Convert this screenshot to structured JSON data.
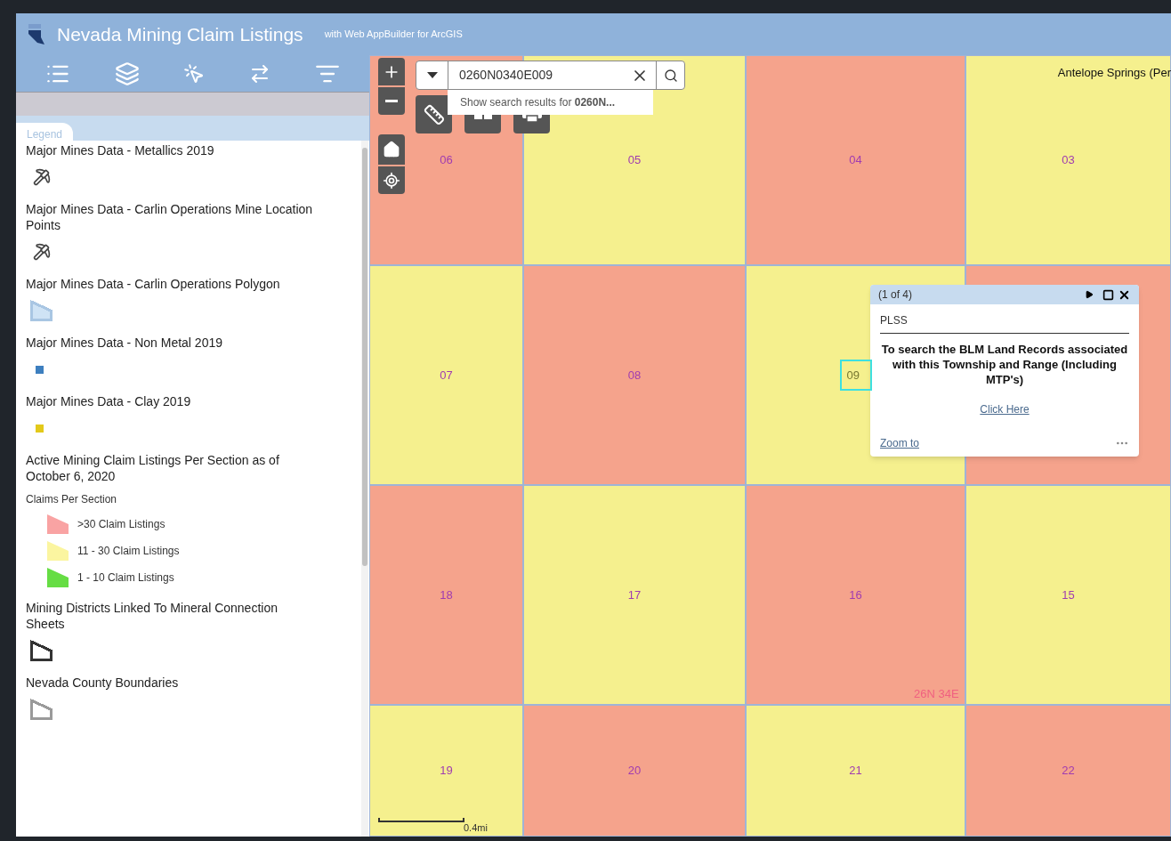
{
  "header": {
    "title": "Nevada Mining Claim Listings",
    "subtitle": "with Web AppBuilder for ArcGIS"
  },
  "legend": {
    "tab": "Legend",
    "layers": [
      {
        "title": "Major Mines Data - Metallics 2019",
        "kind": "mine"
      },
      {
        "title": "Major Mines Data - Carlin Operations Mine Location Points",
        "kind": "mine"
      },
      {
        "title": "Major Mines Data - Carlin Operations Polygon",
        "kind": "polygon",
        "color": "#cfe3f5"
      },
      {
        "title": "Major Mines Data - Non Metal 2019",
        "kind": "square",
        "color": "#3d7fbf"
      },
      {
        "title": "Major Mines Data - Clay 2019",
        "kind": "square",
        "color": "#e3c91a"
      },
      {
        "title": "Active Mining Claim Listings Per Section as of October 6, 2020",
        "kind": "classes",
        "subtitle": "Claims Per Section",
        "classes": [
          {
            "label": ">30 Claim Listings",
            "color": "#f9a3a3"
          },
          {
            "label": "11 - 30 Claim Listings",
            "color": "#fbf5a0"
          },
          {
            "label": "1 - 10 Claim Listings",
            "color": "#66dd44"
          }
        ]
      },
      {
        "title": "Mining Districts Linked To Mineral Connection Sheets",
        "kind": "outline",
        "color": "#333333"
      },
      {
        "title": "Nevada County Boundaries",
        "kind": "outline",
        "color": "#9a9a9a"
      }
    ]
  },
  "map": {
    "search": {
      "value": "0260N0340E009",
      "suggestion": "Show search results for **0260N...**"
    },
    "place_label": "Antelope Springs (Per",
    "township_label": "26N 34E",
    "scale": "0.4mi",
    "sections": [
      [
        {
          "label": "06",
          "color": "#f5a38c",
          "selected": false
        },
        {
          "label": "05",
          "color": "#f5f08e",
          "selected": false
        },
        {
          "label": "04",
          "color": "#f5a38c",
          "selected": false
        },
        {
          "label": "03",
          "color": "#f5f08e",
          "selected": false
        }
      ],
      [
        {
          "label": "07",
          "color": "#f5f08e",
          "selected": false
        },
        {
          "label": "08",
          "color": "#f5a38c",
          "selected": false
        },
        {
          "label": "09",
          "color": "#f5f08e",
          "selected": true
        },
        {
          "color": "#f5a38c",
          "selected": false
        }
      ],
      [
        {
          "label": "18",
          "color": "#f5a38c",
          "selected": false
        },
        {
          "label": "17",
          "color": "#f5f08e",
          "selected": false
        },
        {
          "label": "16",
          "color": "#f5a38c",
          "selected": false
        },
        {
          "label": "15",
          "color": "#f5f08e",
          "selected": false
        }
      ],
      [
        {
          "label": "19",
          "color": "#f5f08e",
          "selected": false
        },
        {
          "label": "20",
          "color": "#f5a38c",
          "selected": false
        },
        {
          "label": "21",
          "color": "#f5f08e",
          "selected": false
        },
        {
          "label": "22",
          "color": "#f5a38c",
          "selected": false
        }
      ]
    ],
    "popup": {
      "counter": "(1 of 4)",
      "layer": "PLSS",
      "message": "To search the BLM Land Records associated with this Township and Range (Including MTP's)",
      "link": "Click Here",
      "zoom": "Zoom to"
    }
  }
}
